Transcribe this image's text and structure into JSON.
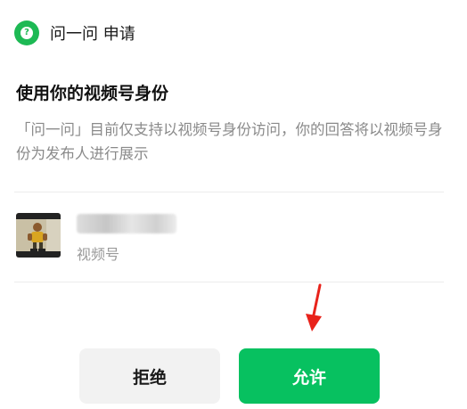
{
  "header": {
    "title": "问一问 申请"
  },
  "section": {
    "title": "使用你的视频号身份",
    "description": "「问一问」目前仅支持以视频号身份访问，你的回答将以视频号身份为发布人进行展示"
  },
  "profile": {
    "type_label": "视频号"
  },
  "buttons": {
    "reject_label": "拒绝",
    "allow_label": "允许"
  },
  "colors": {
    "accent": "#07c160",
    "annotation_arrow": "#e8231b"
  }
}
